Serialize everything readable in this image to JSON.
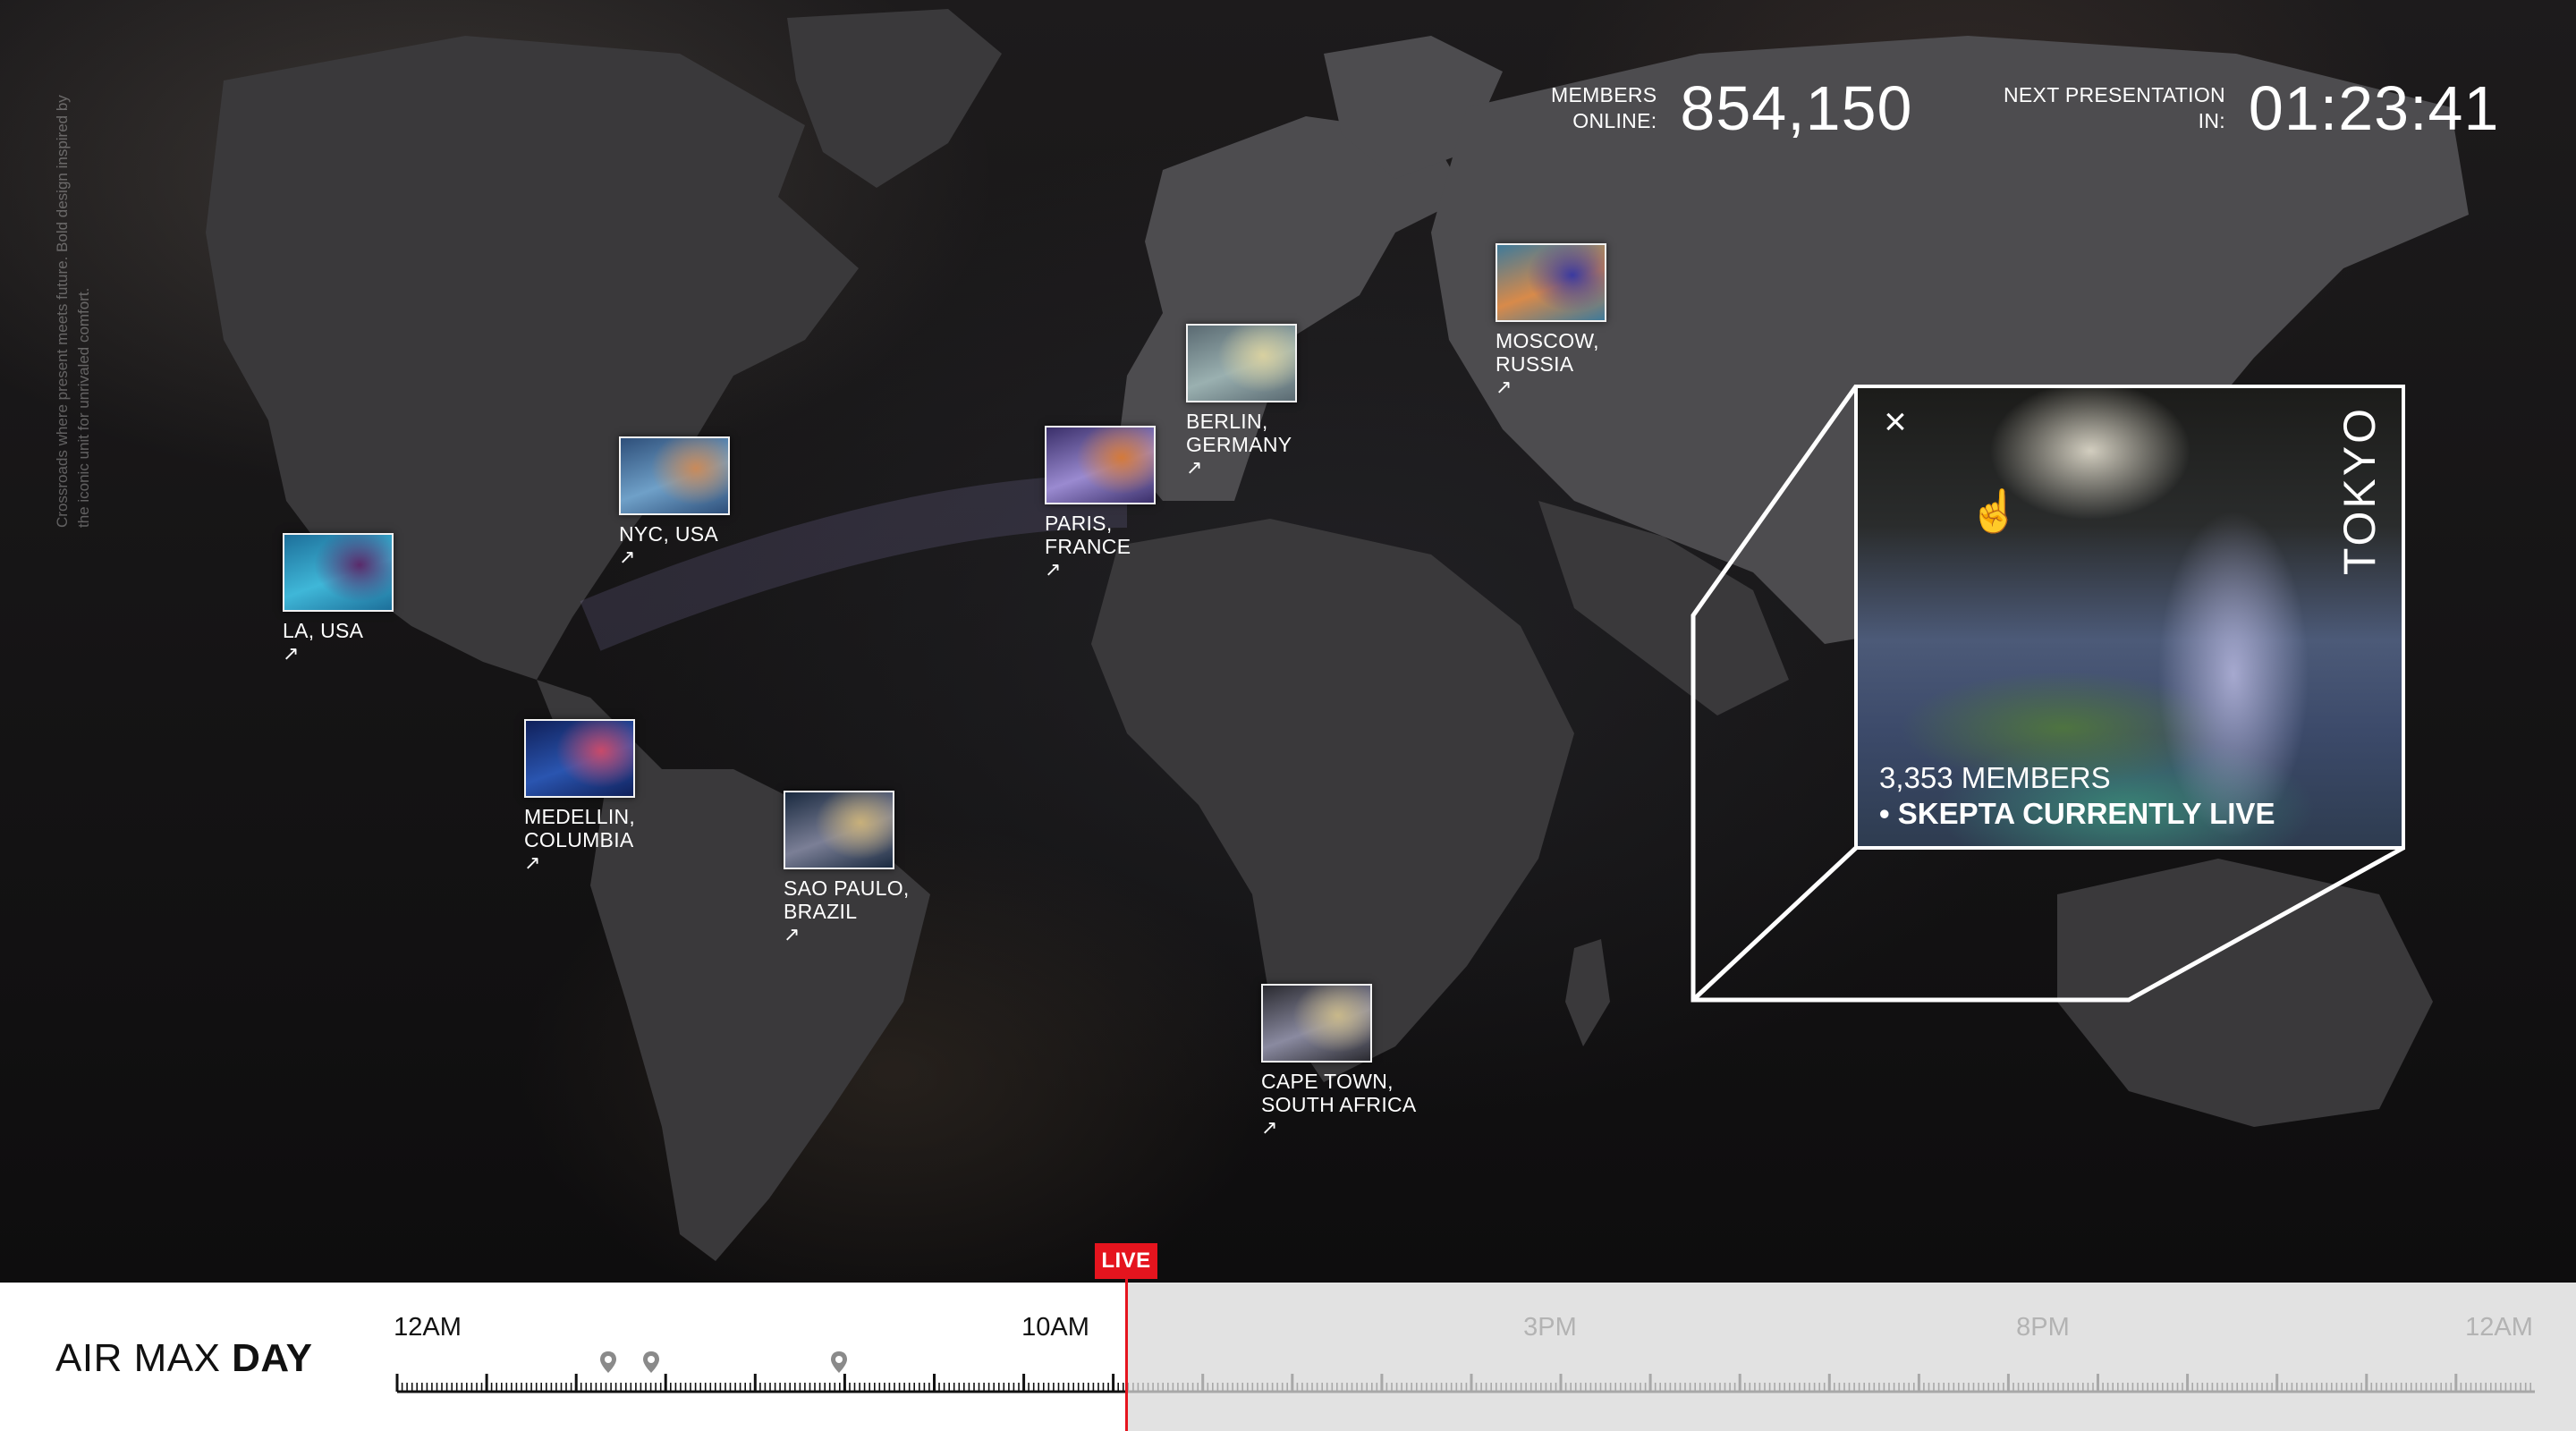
{
  "side_text": "Crossroads where present meets future. Bold design inspired by the iconic unit for unrivaled comfort.",
  "stats": {
    "members_label_line1": "MEMBERS",
    "members_label_line2": "ONLINE:",
    "members_value": "854,150",
    "next_label_line1": "NEXT PRESENTATION",
    "next_label_line2": "IN:",
    "next_value": "01:23:41"
  },
  "cities": [
    {
      "line1": "LA, USA",
      "line2": "",
      "arrow": "↗",
      "thumb_colors": [
        "#1d6f9a",
        "#3fb7d8",
        "#5a2a6a"
      ]
    },
    {
      "line1": "NYC, USA",
      "line2": "",
      "arrow": "↗",
      "thumb_colors": [
        "#2e4f7a",
        "#6fa0c8",
        "#c98a5a"
      ]
    },
    {
      "line1": "MEDELLIN,",
      "line2": "COLUMBIA",
      "arrow": "↗",
      "thumb_colors": [
        "#10205a",
        "#2a55b0",
        "#c84a6a"
      ]
    },
    {
      "line1": "SAO PAULO,",
      "line2": "BRAZIL",
      "arrow": "↗",
      "thumb_colors": [
        "#1a2a40",
        "#7b7f96",
        "#c8b07a"
      ]
    },
    {
      "line1": "PARIS,",
      "line2": "FRANCE",
      "arrow": "↗",
      "thumb_colors": [
        "#3a2f6a",
        "#9a8ad0",
        "#d47a3a"
      ]
    },
    {
      "line1": "BERLIN,",
      "line2": "GERMANY",
      "arrow": "↗",
      "thumb_colors": [
        "#5a6a72",
        "#9ab0b0",
        "#d8d0a0"
      ]
    },
    {
      "line1": "MOSCOW,",
      "line2": "RUSSIA",
      "arrow": "↗",
      "thumb_colors": [
        "#3f7a9a",
        "#d88a4a",
        "#3a3aa0"
      ]
    },
    {
      "line1": "CAPE TOWN,",
      "line2": "SOUTH AFRICA",
      "arrow": "↗",
      "thumb_colors": [
        "#2a2a30",
        "#8a8aa0",
        "#c8b88a"
      ]
    }
  ],
  "tokyo": {
    "city": "TOKYO",
    "close_icon": "×",
    "members": "3,353 MEMBERS",
    "live_status": "• SKEPTA CURRENTLY LIVE"
  },
  "timeline": {
    "brand_light": "AIR MAX ",
    "brand_bold": "DAY",
    "live_label": "LIVE",
    "ticks": [
      "12AM",
      "10AM",
      "3PM",
      "8PM",
      "12AM"
    ]
  }
}
